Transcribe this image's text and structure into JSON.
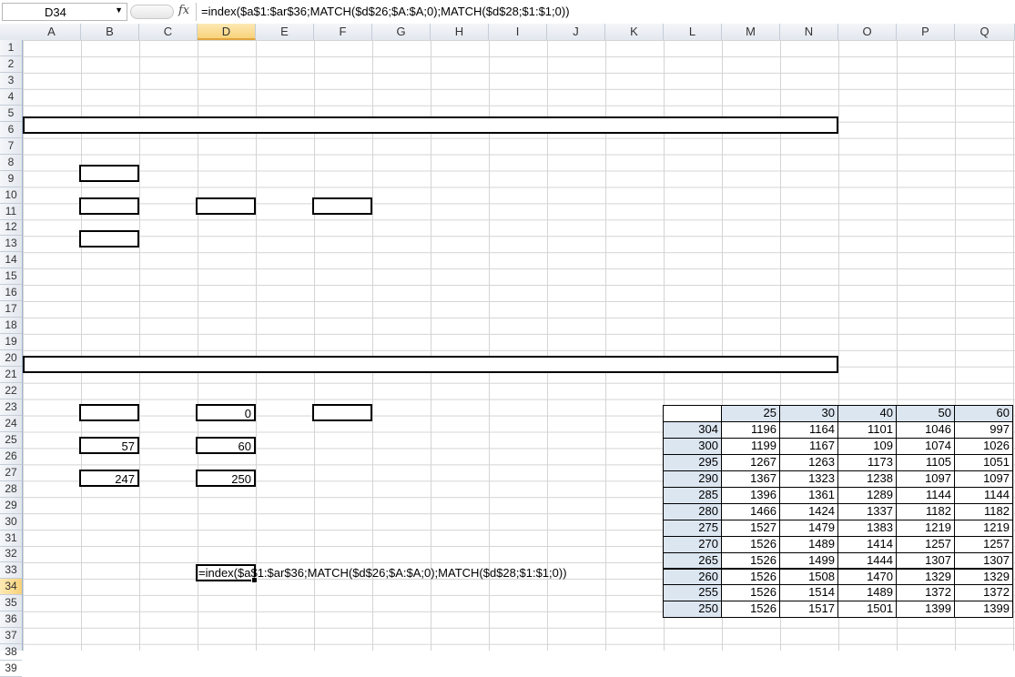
{
  "formula_bar": {
    "name_box": "D34",
    "fx_label": "fx",
    "formula": "=index($a$1:$ar$36;MATCH($d$26;$A:$A;0);MATCH($d$28;$1:$1;0))"
  },
  "columns": [
    "A",
    "B",
    "C",
    "D",
    "E",
    "F",
    "G",
    "H",
    "I",
    "J",
    "K",
    "L",
    "M",
    "N",
    "O",
    "P",
    "Q"
  ],
  "rows": [
    "1",
    "2",
    "3",
    "4",
    "5",
    "6",
    "7",
    "8",
    "9",
    "10",
    "11",
    "12",
    "13",
    "14",
    "15",
    "16",
    "17",
    "18",
    "19",
    "20",
    "21",
    "22",
    "23",
    "24",
    "25",
    "26",
    "27",
    "28",
    "29",
    "30",
    "31",
    "32",
    "33",
    "34",
    "35",
    "36",
    "37",
    "38",
    "39"
  ],
  "selected": {
    "column": "D",
    "row": "34"
  },
  "cells": {
    "D24": "0",
    "B26": "57",
    "D26": "60",
    "B28": "247",
    "D28": "250",
    "D34": "=index($a$1:$ar$36;MATCH($d$26;$A:$A;0);MATCH($d$28;$1:$1;0))"
  },
  "lookup_table": {
    "header_row": [
      "",
      "25",
      "30",
      "40",
      "50",
      "60"
    ],
    "rows": [
      [
        "304",
        "1196",
        "1164",
        "1101",
        "1046",
        "997"
      ],
      [
        "300",
        "1199",
        "1167",
        "109",
        "1074",
        "1026"
      ],
      [
        "295",
        "1267",
        "1263",
        "1173",
        "1105",
        "1051"
      ],
      [
        "290",
        "1367",
        "1323",
        "1238",
        "1097",
        "1097"
      ],
      [
        "285",
        "1396",
        "1361",
        "1289",
        "1144",
        "1144"
      ],
      [
        "280",
        "1466",
        "1424",
        "1337",
        "1182",
        "1182"
      ],
      [
        "275",
        "1527",
        "1479",
        "1383",
        "1219",
        "1219"
      ],
      [
        "270",
        "1526",
        "1489",
        "1414",
        "1257",
        "1257"
      ],
      [
        "265",
        "1526",
        "1499",
        "1444",
        "1307",
        "1307"
      ],
      [
        "260",
        "1526",
        "1508",
        "1470",
        "1329",
        "1329"
      ],
      [
        "255",
        "1526",
        "1514",
        "1489",
        "1372",
        "1372"
      ],
      [
        "250",
        "1526",
        "1517",
        "1501",
        "1399",
        "1399"
      ]
    ]
  },
  "colors": {
    "header_fill": "#dce6f1",
    "selected_header": "#f8d27a",
    "gridline": "#d4d4d4"
  }
}
